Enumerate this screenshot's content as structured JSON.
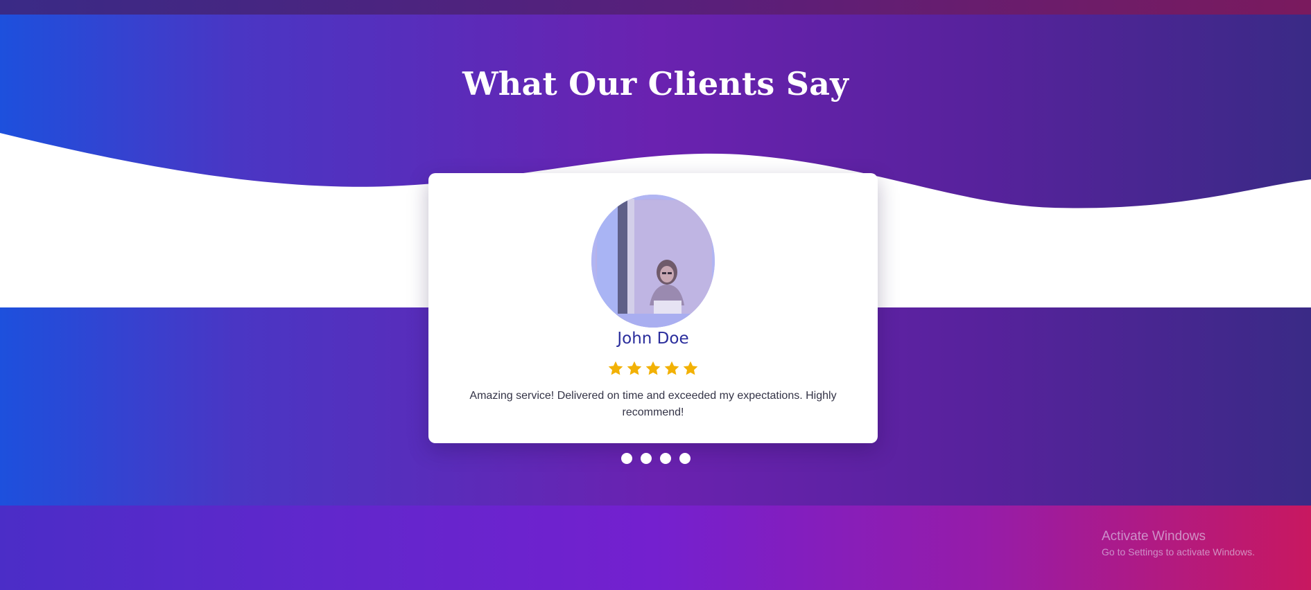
{
  "section": {
    "title": "What Our Clients Say"
  },
  "testimonial": {
    "name": "John Doe",
    "rating": 5,
    "rating_max": 5,
    "text": "Amazing service! Delivered on time and exceeded my expectations. Highly recommend!",
    "photo_icon": "woman-laptop-photo"
  },
  "carousel": {
    "dot_count": 4
  },
  "watermark": {
    "title": "Activate Windows",
    "subtitle": "Go to Settings to activate Windows."
  },
  "colors": {
    "title_text": "#ffffff",
    "name_text": "#2a2d9c",
    "star": "#f2b105",
    "dot": "#ffffff",
    "gradient_start": "#1d50dd",
    "gradient_mid": "#6a22b0",
    "gradient_end": "#3a2a86"
  }
}
